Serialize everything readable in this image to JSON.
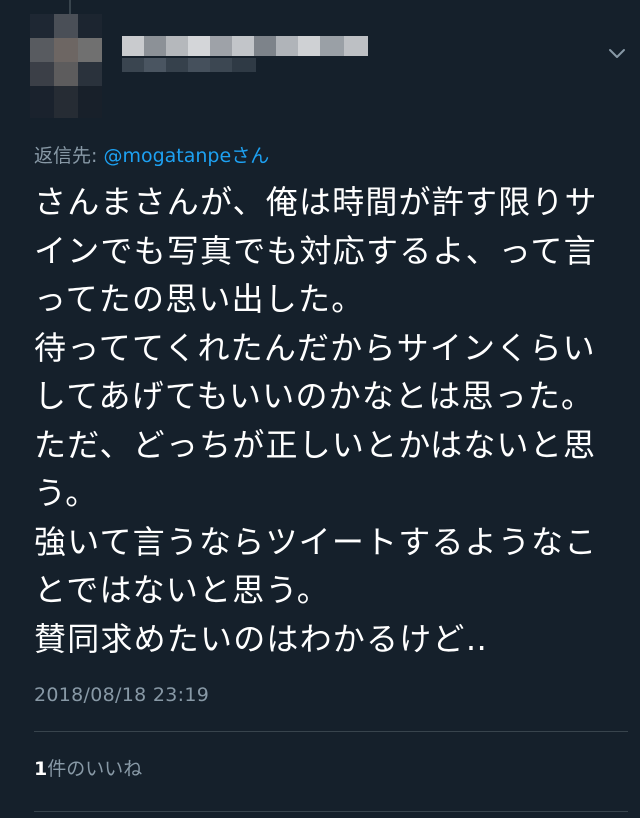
{
  "tweet": {
    "reply_to_prefix": "返信先: ",
    "reply_to_handle": "@mogatanpe",
    "reply_to_suffix": "さん",
    "body_lines": [
      "さんまさんが、俺は時間が許す限りサ",
      "インでも写真でも対応するよ、って言",
      "ってたの思い出した。",
      "待っててくれたんだからサインくらい",
      "してあげてもいいのかなとは思った。",
      "ただ、どっちが正しいとかはないと思",
      "う。",
      "強いて言うならツイートするようなこ",
      "とではないと思う。",
      "賛同求めたいのはわかるけど‥"
    ],
    "timestamp": "2018/08/18 23:19",
    "likes_count": "1",
    "likes_label": "件のいいね"
  },
  "icons": {
    "more_menu": "chevron-down-icon"
  },
  "colors": {
    "background": "#15202b",
    "text": "#ffffff",
    "secondary_text": "#8899a6",
    "accent": "#1da1f2",
    "divider": "#38444d"
  }
}
